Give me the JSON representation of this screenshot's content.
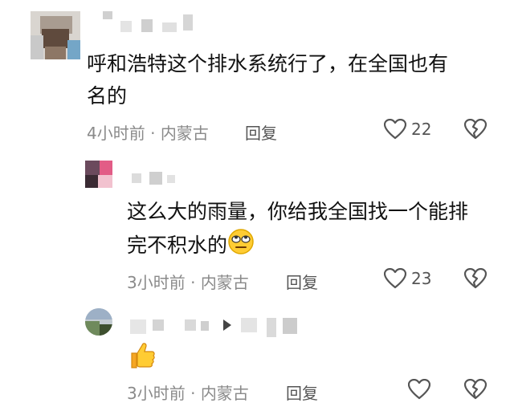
{
  "comments": [
    {
      "text_line1": "呼和浩特这个排水系统行了，在全国也有",
      "text_line2": "名的",
      "time": "4小时前",
      "dot": "·",
      "location": "内蒙古",
      "reply_label": "回复",
      "like_count": "22",
      "avatar_colors": [
        "#c9c9c9",
        "#8d7766",
        "#5f4a3d",
        "#b9b3ad",
        "#74a6c7",
        "#d9d5d0"
      ]
    },
    {
      "text_line1": "这么大的雨量，你给我全国找一个能排",
      "text_line2": "完不积水的",
      "time": "3小时前",
      "dot": "·",
      "location": "内蒙古",
      "reply_label": "回复",
      "like_count": "23",
      "avatar_colors": [
        "#6b4a5d",
        "#e25c86",
        "#f2c2cf",
        "#3a2a33"
      ]
    },
    {
      "time": "3小时前",
      "dot": "·",
      "location": "内蒙古",
      "reply_label": "回复",
      "like_count": "",
      "avatar_colors": [
        "#6f8a5c",
        "#9db0c6",
        "#3d4f2e",
        "#c3cbd1"
      ]
    }
  ],
  "icons": {
    "like": "heart-outline-icon",
    "dislike": "broken-heart-outline-icon",
    "emoji_rolling_eyes": "rolling-eyes-emoji",
    "emoji_thumbs_up": "thumbs-up-emoji"
  },
  "colors": {
    "text": "#111111",
    "meta": "#8a8a8a",
    "icon": "#555555"
  }
}
